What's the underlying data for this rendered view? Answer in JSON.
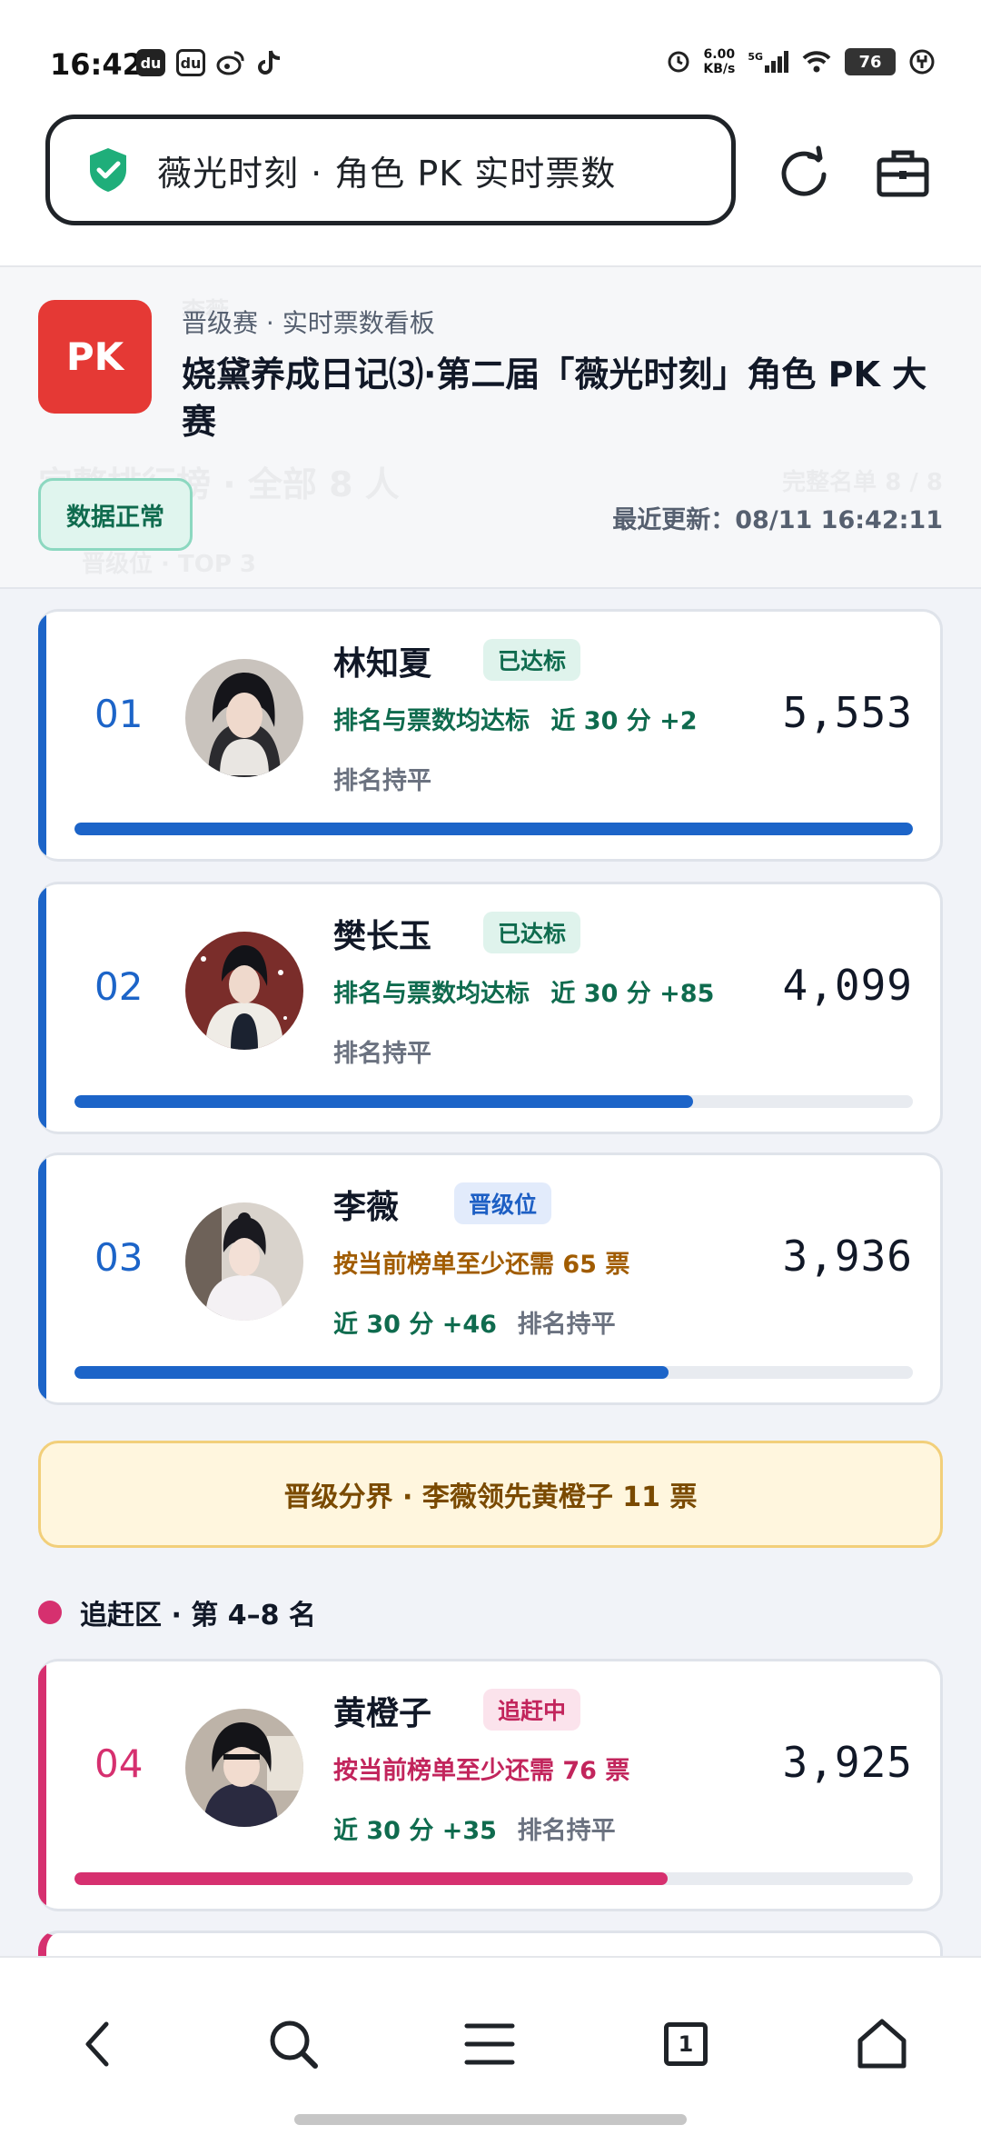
{
  "status_bar": {
    "time": "16:42",
    "app_icons": [
      "du",
      "du",
      "weibo-icon",
      "tiktok-icon"
    ],
    "net_speed_value": "6.00",
    "net_speed_unit": "KB/s",
    "network": "5G",
    "battery": "76"
  },
  "browser": {
    "url_title": "薇光时刻 · 角色 PK 实时票数",
    "security_icon": "shield-check-icon"
  },
  "header": {
    "badge": "PK",
    "subtitle": "晋级赛 · 实时票数看板",
    "title": "娆黛养成日记⑶·第二届「薇光时刻」角色 PK 大赛",
    "status": "数据正常",
    "updated": "最近更新：08/11 16:42:11",
    "ghost_1": "完整排行榜 · 全部 8 人",
    "ghost_2": "完整名单 8 / 8",
    "ghost_3": "晋级位 · TOP 3",
    "ghost_4": "李薇"
  },
  "candidates": [
    {
      "rank": "01",
      "name": "林知夏",
      "tag": "已达标",
      "line2a": "排名与票数均达标",
      "line2b": "近 30 分 +2",
      "line3a": "排名持平",
      "line3b": "",
      "votes": "5,553",
      "progress": 1.0
    },
    {
      "rank": "02",
      "name": "樊长玉",
      "tag": "已达标",
      "line2a": "排名与票数均达标",
      "line2b": "近 30 分 +85",
      "line3a": "排名持平",
      "line3b": "",
      "votes": "4,099",
      "progress": 0.738
    },
    {
      "rank": "03",
      "name": "李薇",
      "tag": "晋级位",
      "line2a": "按当前榜单至少还需 65 票",
      "line2b": "",
      "line3a": "近 30 分 +46",
      "line3b": "排名持平",
      "votes": "3,936",
      "progress": 0.709
    },
    {
      "rank": "04",
      "name": "黄橙子",
      "tag": "追赶中",
      "line2a": "按当前榜单至少还需 76 票",
      "line2b": "",
      "line3a": "近 30 分 +35",
      "line3b": "排名持平",
      "votes": "3,925",
      "progress": 0.707
    }
  ],
  "boundary_text": "晋级分界 · 李薇领先黄橙子 11 票",
  "section_title": "追赶区 · 第 4–8 名",
  "tab_count": "1",
  "colors": {
    "blue": "#1c64c8",
    "pink": "#d6306f",
    "green": "#0f6b4e",
    "red": "#e53935"
  }
}
